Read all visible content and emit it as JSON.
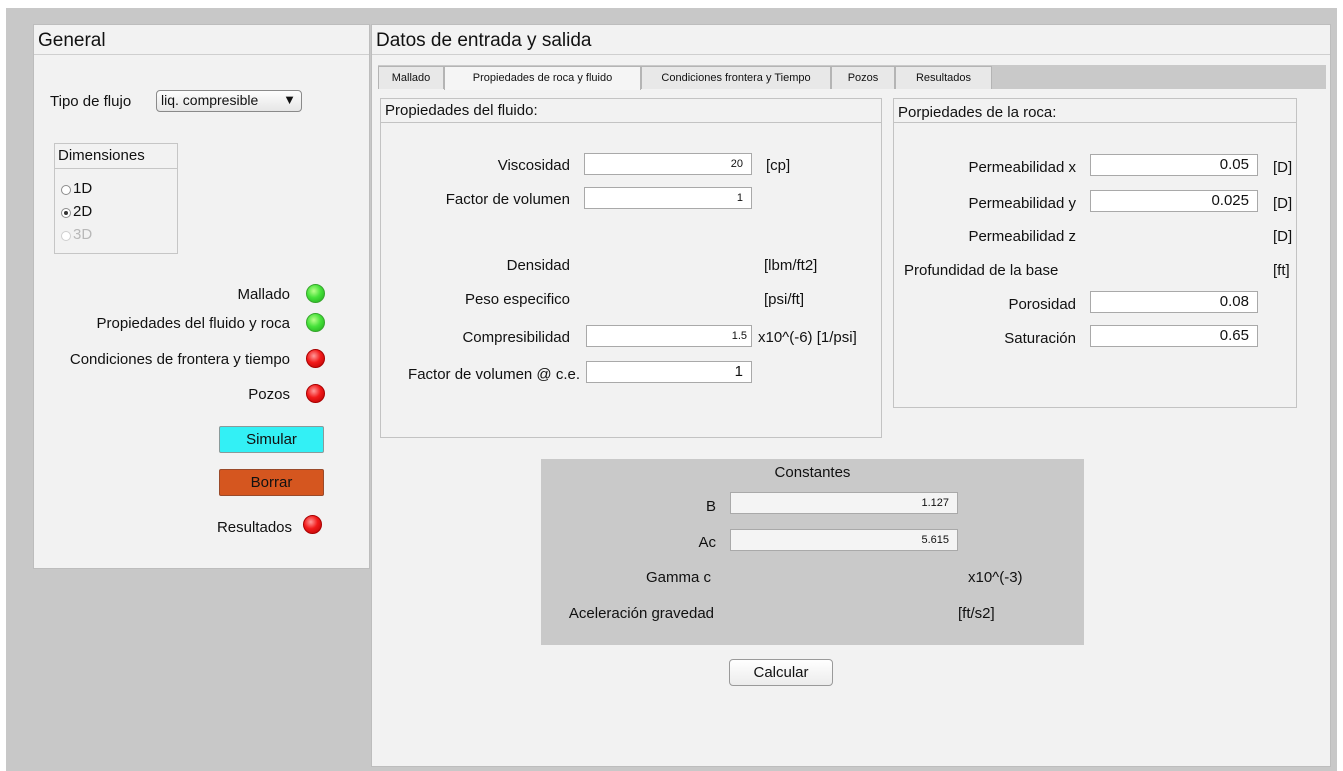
{
  "general": {
    "title": "General",
    "flow_type_label": "Tipo de flujo",
    "flow_type_value": "liq. compresible",
    "dropdown_arrow": "▼",
    "dimensions": {
      "title": "Dimensiones",
      "options": [
        {
          "label": "1D",
          "selected": false,
          "disabled": false
        },
        {
          "label": "2D",
          "selected": true,
          "disabled": false
        },
        {
          "label": "3D",
          "selected": false,
          "disabled": true
        }
      ]
    },
    "status": [
      {
        "label": "Mallado",
        "state": "green"
      },
      {
        "label": "Propiedades del fluido y roca",
        "state": "green"
      },
      {
        "label": "Condiciones de frontera y tiempo",
        "state": "red"
      },
      {
        "label": "Pozos",
        "state": "red"
      }
    ],
    "simulate_button": "Simular",
    "clear_button": "Borrar",
    "results_label": "Resultados",
    "results_state": "red",
    "colors": {
      "simulate": "#33f0f5",
      "clear": "#d5561f",
      "green": "#3edc35",
      "red": "#ea0f0f"
    }
  },
  "data_panel": {
    "title": "Datos de entrada y salida",
    "tabs": [
      "Mallado",
      "Propiedades de roca y fluido",
      "Condiciones frontera y Tiempo",
      "Pozos",
      "Resultados"
    ],
    "active_tab": "Propiedades de roca y fluido"
  },
  "fluid": {
    "title": "Propiedades del fluido:",
    "viscosity_label": "Viscosidad",
    "viscosity_value": "20",
    "viscosity_unit": "[cp]",
    "volume_factor_label": "Factor de volumen",
    "volume_factor_value": "1",
    "density_label": "Densidad",
    "density_unit": "[lbm/ft2]",
    "specific_weight_label": "Peso especifico",
    "specific_weight_unit": "[psi/ft]",
    "compressibility_label": "Compresibilidad",
    "compressibility_value": "1.5",
    "compressibility_unit": "x10^(-6) [1/psi]",
    "volume_factor_ce_label": "Factor de volumen @ c.e.",
    "volume_factor_ce_value": "1"
  },
  "rock": {
    "title": "Porpiedades de la roca:",
    "perm_x_label": "Permeabilidad x",
    "perm_x_value": "0.05",
    "perm_x_unit": "[D]",
    "perm_y_label": "Permeabilidad y",
    "perm_y_value": "0.025",
    "perm_y_unit": "[D]",
    "perm_z_label": "Permeabilidad z",
    "perm_z_unit": "[D]",
    "base_depth_label": "Profundidad de la base",
    "base_depth_unit": "[ft]",
    "porosity_label": "Porosidad",
    "porosity_value": "0.08",
    "saturation_label": "Saturación",
    "saturation_value": "0.65"
  },
  "constants": {
    "title": "Constantes",
    "b_label": "B",
    "b_value": "1.127",
    "ac_label": "Ac",
    "ac_value": "5.615",
    "gamma_label": "Gamma c",
    "gamma_unit": "x10^(-3)",
    "gravity_label": "Aceleración gravedad",
    "gravity_unit": "[ft/s2]"
  },
  "calculate_button": "Calcular"
}
